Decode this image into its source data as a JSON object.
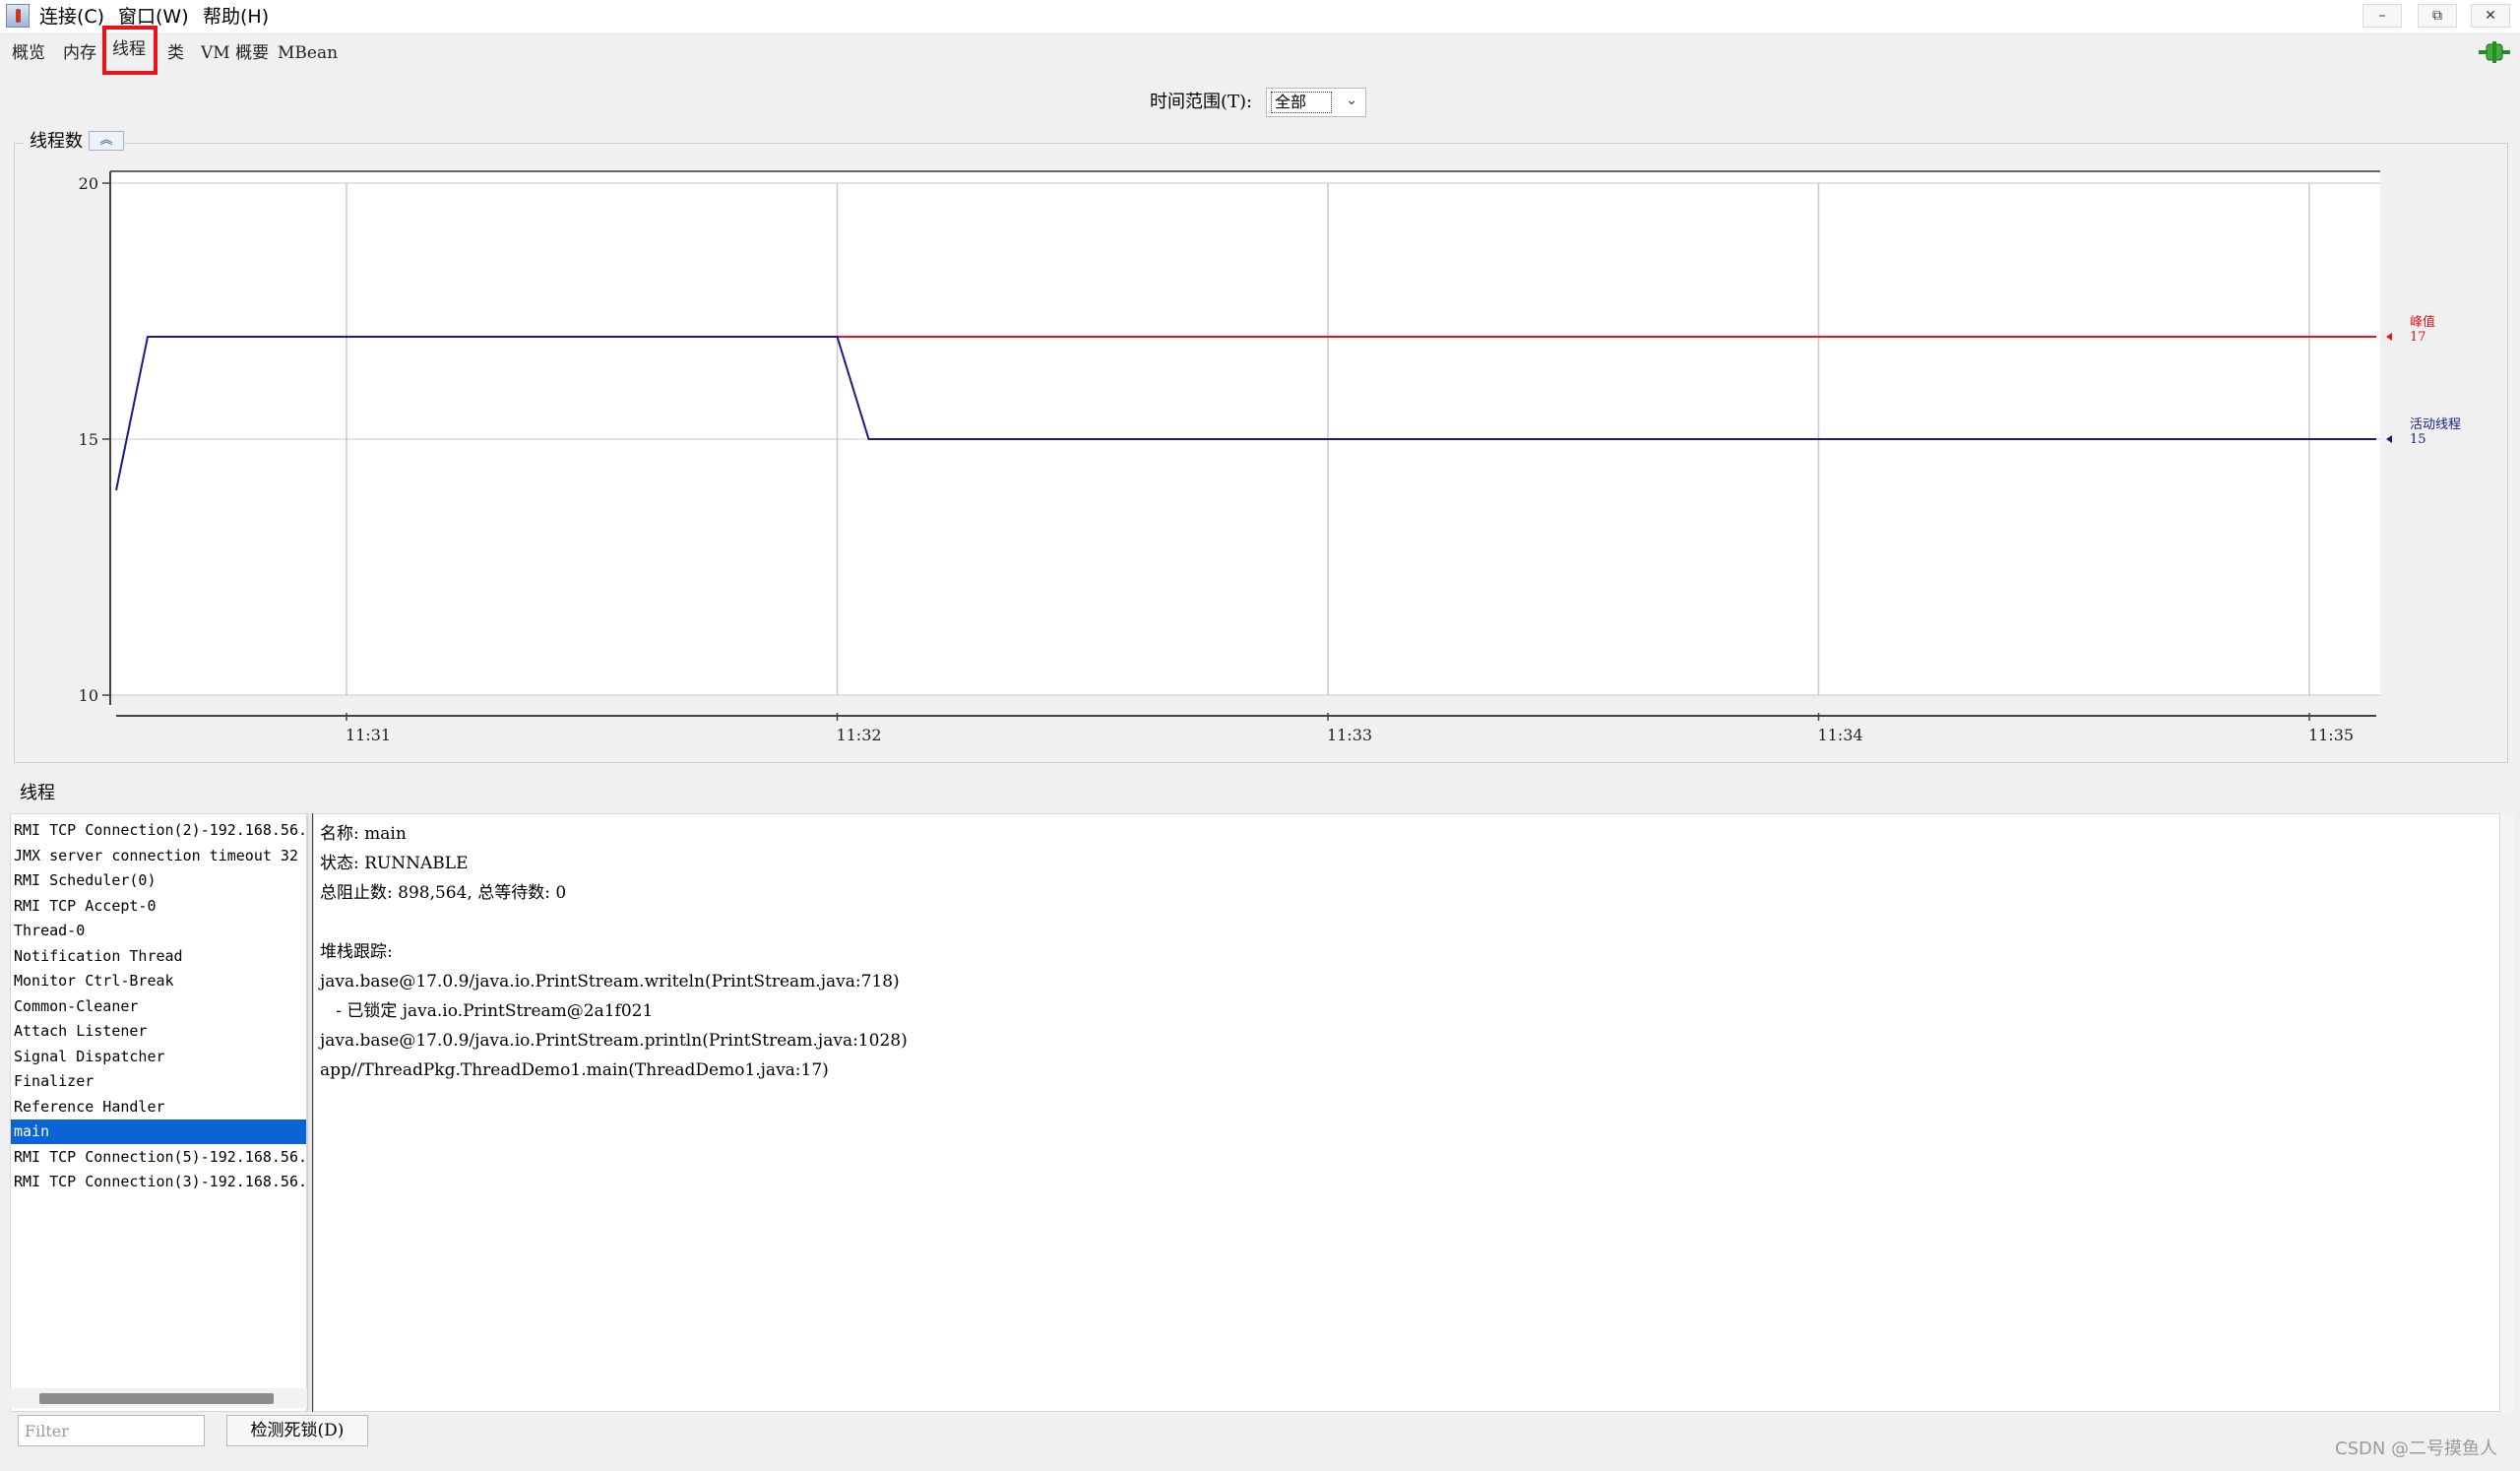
{
  "menu": {
    "items": [
      "连接(C)",
      "窗口(W)",
      "帮助(H)"
    ]
  },
  "window_controls": {
    "minimize": "–",
    "restore": "⧉",
    "close": "✕"
  },
  "tabs": [
    {
      "label": "概览"
    },
    {
      "label": "内存"
    },
    {
      "label": "线程",
      "active": true
    },
    {
      "label": "类"
    },
    {
      "label": "VM 概要"
    },
    {
      "label": "MBean"
    }
  ],
  "time_range": {
    "label": "时间范围(T):",
    "value": "全部"
  },
  "chart_panel": {
    "title": "线程数",
    "collapse_icon": "double-chevron-up-icon"
  },
  "chart_data": {
    "type": "line",
    "ylim": [
      10,
      20
    ],
    "yticks": [
      10,
      15,
      20
    ],
    "xticks": [
      "11:31",
      "11:32",
      "11:33",
      "11:34",
      "11:35"
    ],
    "grid": true,
    "series": [
      {
        "name": "峰值",
        "color": "#e8131b",
        "current": "17",
        "points": [
          [
            "11:32",
            17
          ],
          [
            "11:35+",
            17
          ]
        ]
      },
      {
        "name": "活动线程",
        "color": "#1a1a8c",
        "current": "15",
        "points": [
          [
            "start",
            14
          ],
          [
            "start+",
            17
          ],
          [
            "11:32",
            17
          ],
          [
            "11:32+",
            15
          ],
          [
            "11:35+",
            15
          ]
        ]
      }
    ]
  },
  "threads": {
    "title": "线程",
    "list": [
      "RMI TCP Connection(2)-192.168.56.",
      "JMX server connection timeout 32",
      "RMI Scheduler(0)",
      "RMI TCP Accept-0",
      "Thread-0",
      "Notification Thread",
      "Monitor Ctrl-Break",
      "Common-Cleaner",
      "Attach Listener",
      "Signal Dispatcher",
      "Finalizer",
      "Reference Handler",
      "main",
      "RMI TCP Connection(5)-192.168.56.",
      "RMI TCP Connection(3)-192.168.56."
    ],
    "selected_index": 12
  },
  "detail": {
    "name_line": "名称: main",
    "state_line": "状态: RUNNABLE",
    "counts_line": "总阻止数: 898,564, 总等待数: 0",
    "stack_title": "堆栈跟踪:",
    "stack": [
      "java.base@17.0.9/java.io.PrintStream.writeln(PrintStream.java:718)",
      "   - 已锁定 java.io.PrintStream@2a1f021",
      "java.base@17.0.9/java.io.PrintStream.println(PrintStream.java:1028)",
      "app//ThreadPkg.ThreadDemo1.main(ThreadDemo1.java:17)"
    ]
  },
  "filter": {
    "placeholder": "Filter",
    "value": ""
  },
  "deadlock_button": "检测死锁(D)",
  "watermark": "CSDN @二号摸鱼人"
}
